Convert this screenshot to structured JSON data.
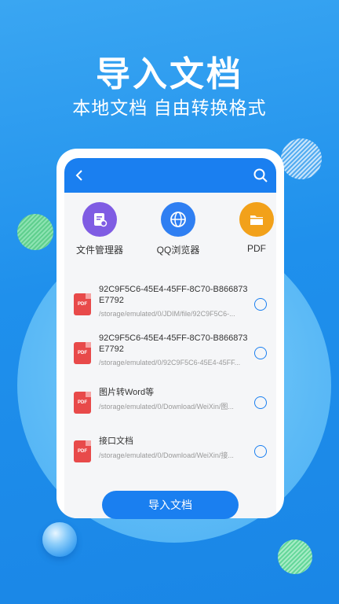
{
  "promo": {
    "headline": "导入文档",
    "subhead": "本地文档  自由转换格式"
  },
  "app": {
    "quick_actions": [
      {
        "label": "文件管理器",
        "icon": "file-manager-icon",
        "color": "#7f5ce3"
      },
      {
        "label": "QQ浏览器",
        "icon": "globe-icon",
        "color": "#2f7ff2"
      },
      {
        "label": "PDF",
        "icon": "folder-icon",
        "color": "#f2a11a"
      }
    ],
    "files": [
      {
        "icon_text": "PDF",
        "name": "92C9F5C6-45E4-45FF-8C70-B866873E7792",
        "path": "/storage/emulated/0/JDIM/file/92C9F5C6-..."
      },
      {
        "icon_text": "PDF",
        "name": "92C9F5C6-45E4-45FF-8C70-B866873E7792",
        "path": "/storage/emulated/0/92C9F5C6-45E4-45FF..."
      },
      {
        "icon_text": "PDF",
        "name": "图片转Word等",
        "path": "/storage/emulated/0/Download/WeiXin/图..."
      },
      {
        "icon_text": "PDF",
        "name": "接口文档",
        "path": "/storage/emulated/0/Download/WeiXin/接..."
      }
    ],
    "import_button": "导入文档"
  },
  "colors": {
    "accent": "#1a7ff0",
    "pdf_red": "#e84a4a"
  }
}
